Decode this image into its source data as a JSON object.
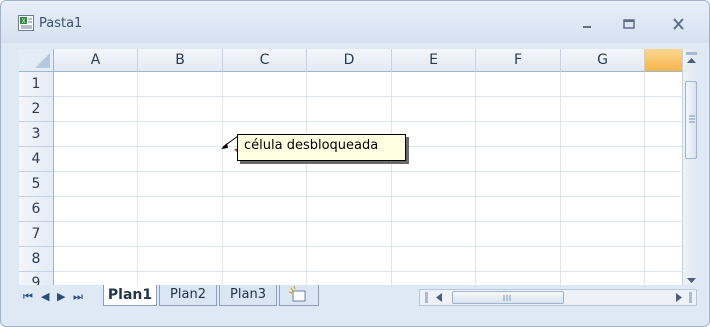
{
  "window": {
    "title": "Pasta1",
    "minimize": "–",
    "maximize": "▭",
    "close": "x"
  },
  "grid": {
    "columns": [
      "A",
      "B",
      "C",
      "D",
      "E",
      "F",
      "G"
    ],
    "rows": [
      "1",
      "2",
      "3",
      "4",
      "5",
      "6",
      "7",
      "8",
      "9"
    ],
    "selected_column_color": "#f6b54b"
  },
  "comment": {
    "text": "célula desbloqueada",
    "indicator_color": "#d42020"
  },
  "sheets": {
    "tabs": [
      "Plan1",
      "Plan2",
      "Plan3"
    ],
    "active": "Plan1",
    "new_sheet_icon": "insert-worksheet-icon"
  },
  "nav": {
    "first": "⏮",
    "prev": "◀",
    "next": "▶",
    "last": "⏭"
  }
}
